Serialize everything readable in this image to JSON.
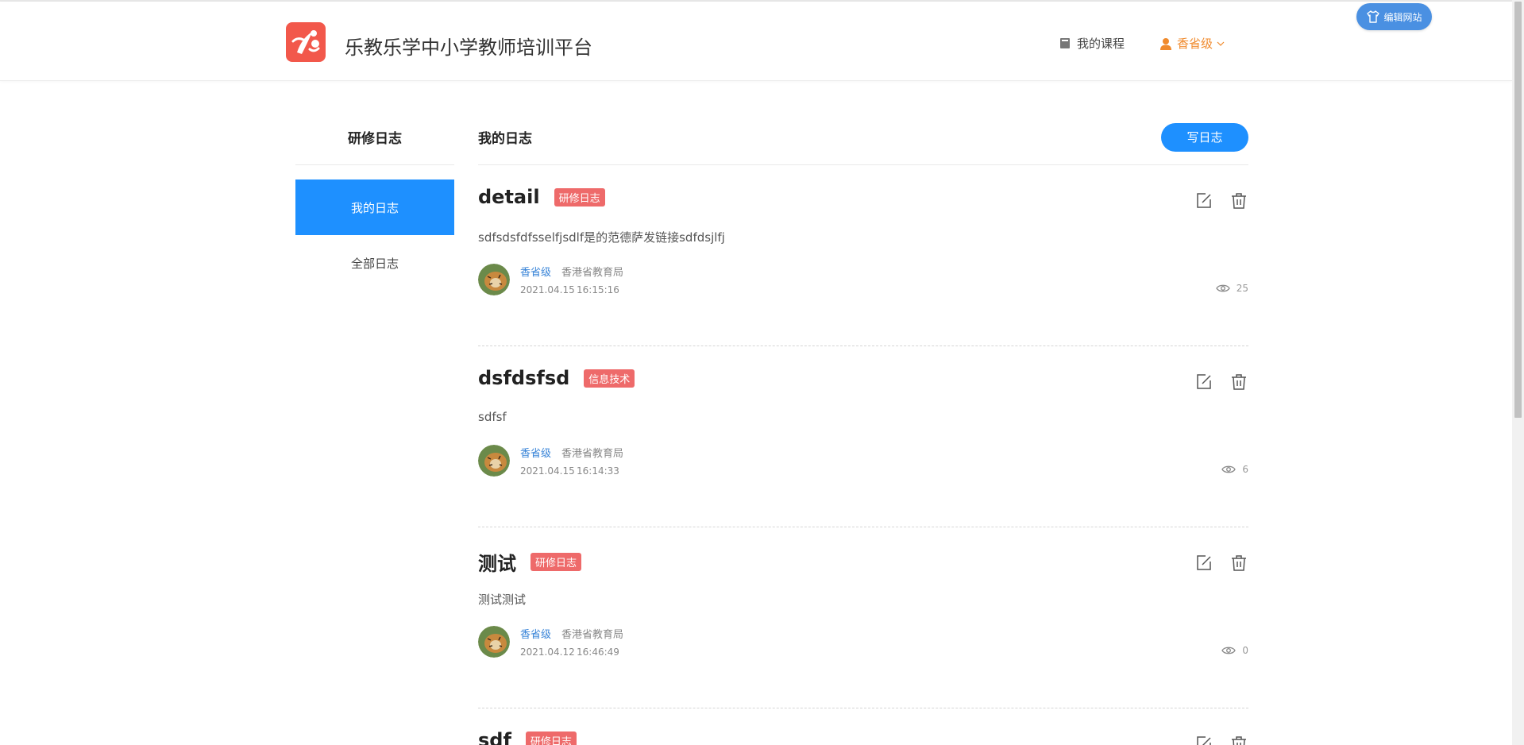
{
  "header": {
    "site_title": "乐教乐学中小学教师培训平台",
    "nav_course": "我的课程",
    "nav_user": "香省级",
    "edit_site": "编辑网站"
  },
  "colors": {
    "brand_red": "#f2584b",
    "primary_blue": "#1e90ff",
    "user_orange": "#f08a2c",
    "tag_red": "#ee6a6a",
    "author_blue": "#3a85d8"
  },
  "sidebar": {
    "title": "研修日志",
    "items": [
      {
        "label": "我的日志",
        "active": true
      },
      {
        "label": "全部日志",
        "active": false
      }
    ]
  },
  "main": {
    "title": "我的日志",
    "write_button": "写日志",
    "entries": [
      {
        "title": "detail",
        "tag": "研修日志",
        "excerpt": "sdfsdsfdfsselfjsdlf是的范德萨发链接sdfdsjlfj",
        "author": "香省级",
        "org": "香港省教育局",
        "date": "2021.04.15",
        "time": "16:15:16",
        "views": "25"
      },
      {
        "title": "dsfdsfsd",
        "tag": "信息技术",
        "excerpt": "sdfsf",
        "author": "香省级",
        "org": "香港省教育局",
        "date": "2021.04.15",
        "time": "16:14:33",
        "views": "6"
      },
      {
        "title": "测试",
        "tag": "研修日志",
        "excerpt": "测试测试",
        "author": "香省级",
        "org": "香港省教育局",
        "date": "2021.04.12",
        "time": "16:46:49",
        "views": "0"
      },
      {
        "title": "sdf",
        "tag": "研修日志"
      }
    ]
  },
  "icons": [
    "logo-icon",
    "book-icon",
    "user-icon",
    "chevron-down-icon",
    "shirt-icon",
    "edit-icon",
    "trash-icon",
    "eye-icon"
  ]
}
